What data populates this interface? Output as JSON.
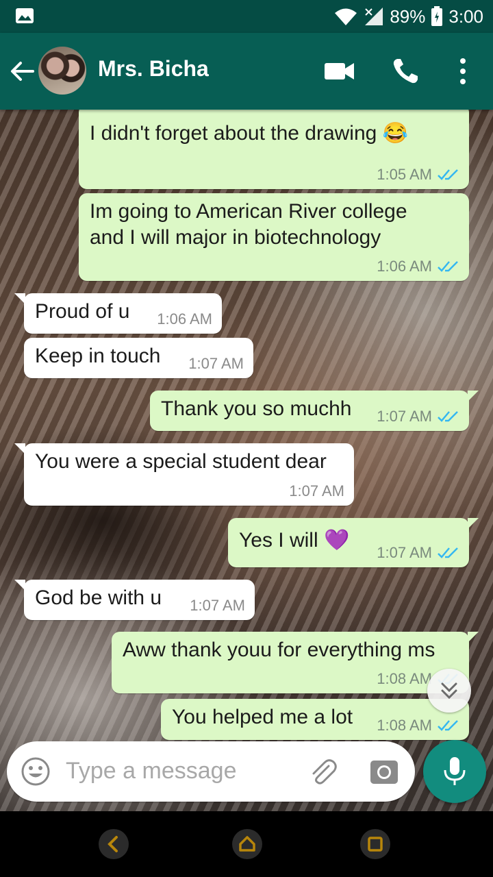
{
  "status_bar": {
    "battery": "89%",
    "time": "3:00",
    "icons": [
      "image-icon",
      "wifi-icon",
      "signal-icon",
      "battery-icon"
    ]
  },
  "header": {
    "contact_name": "Mrs. Bicha",
    "icons": [
      "back-arrow-icon",
      "video-call-icon",
      "phone-icon",
      "more-vert-icon"
    ]
  },
  "messages": [
    {
      "dir": "out",
      "lines": [
        "I didn't forget about the drawing 😂"
      ],
      "time": "1:05 AM",
      "status": "read"
    },
    {
      "dir": "out",
      "lines": [
        "Im going to American River college",
        "and I will major in biotechnology"
      ],
      "time": "1:06 AM",
      "status": "read"
    },
    {
      "dir": "in",
      "lines": [
        "Proud of u"
      ],
      "time": "1:06 AM"
    },
    {
      "dir": "in",
      "lines": [
        "Keep in touch"
      ],
      "time": "1:07 AM"
    },
    {
      "dir": "out",
      "lines": [
        "Thank you so muchh"
      ],
      "time": "1:07 AM",
      "status": "read"
    },
    {
      "dir": "in",
      "lines": [
        "You were a special student dear"
      ],
      "time": "1:07 AM"
    },
    {
      "dir": "out",
      "lines": [
        "Yes I will 💜"
      ],
      "time": "1:07 AM",
      "status": "read"
    },
    {
      "dir": "in",
      "lines": [
        "God be with u"
      ],
      "time": "1:07 AM"
    },
    {
      "dir": "out",
      "lines": [
        "Aww thank youu for everything ms"
      ],
      "time": "1:08 AM",
      "status": "read"
    },
    {
      "dir": "out",
      "lines": [
        "You helped me a lot"
      ],
      "time": "1:08 AM",
      "status": "read"
    }
  ],
  "composer": {
    "placeholder": "Type a message",
    "icons": [
      "emoji-icon",
      "attach-icon",
      "camera-icon",
      "mic-icon"
    ]
  },
  "colors": {
    "header": "#075e54",
    "status_bar": "#054c44",
    "outgoing_bubble": "#dcf8c6",
    "incoming_bubble": "#ffffff",
    "read_tick": "#34b7f1",
    "mic_button": "#128c7e"
  }
}
